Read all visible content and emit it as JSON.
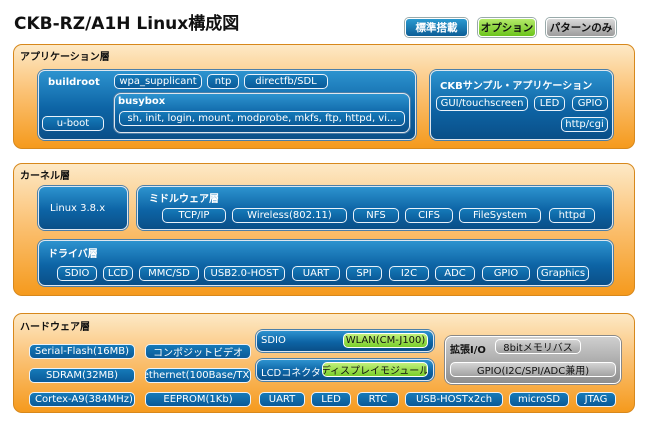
{
  "title": "CKB-RZ/A1H Linux構成図",
  "legend": {
    "standard": "標準搭載",
    "option": "オプション",
    "pattern_only": "パターンのみ"
  },
  "application_layer": {
    "title": "アプリケーション層",
    "buildroot": {
      "label": "buildroot",
      "items": [
        "wpa_supplicant",
        "ntp",
        "directfb/SDL"
      ],
      "uboot": "u-boot",
      "busybox": {
        "label": "busybox",
        "commands": "sh, init, login, mount, modprobe, mkfs, ftp, httpd, vi..."
      }
    },
    "ckb_apps": {
      "label": "CKBサンプル・アプリケーション",
      "items": [
        "GUI/touchscreen",
        "LED",
        "GPIO",
        "http/cgi"
      ]
    }
  },
  "kernel_layer": {
    "title": "カーネル層",
    "linux_version": "Linux 3.8.x",
    "middleware": {
      "label": "ミドルウェア層",
      "items": [
        "TCP/IP",
        "Wireless(802.11)",
        "NFS",
        "CIFS",
        "FileSystem",
        "httpd"
      ]
    },
    "drivers": {
      "label": "ドライバ層",
      "items": [
        "SDIO",
        "LCD",
        "MMC/SD",
        "USB2.0-HOST",
        "UART",
        "SPI",
        "I2C",
        "ADC",
        "GPIO",
        "Graphics"
      ]
    }
  },
  "hardware_layer": {
    "title": "ハードウェア層",
    "left": [
      "Serial-Flash(16MB)",
      "コンポジットビデオ",
      "SDRAM(32MB)",
      "ethernet(100Base/TX)"
    ],
    "sdio": {
      "label": "SDIO",
      "item": "WLAN(CM-J100)"
    },
    "lcd": {
      "label": "LCDコネクタ",
      "item": "ディスプレイモジュール"
    },
    "expansion": {
      "label": "拡張I/O",
      "items": [
        "8bitメモリバス",
        "GPIO(I2C/SPI/ADC兼用)"
      ]
    },
    "bottom": [
      "Cortex-A9(384MHz)",
      "EEPROM(1Kb)",
      "UART",
      "LED",
      "RTC",
      "USB-HOSTx2ch",
      "microSD",
      "JTAG"
    ]
  },
  "colors": {
    "standard": "#0f6aa8",
    "option": "#8bd43a",
    "pattern_only": "#a8a8a8",
    "layer": "#f7a52e"
  }
}
